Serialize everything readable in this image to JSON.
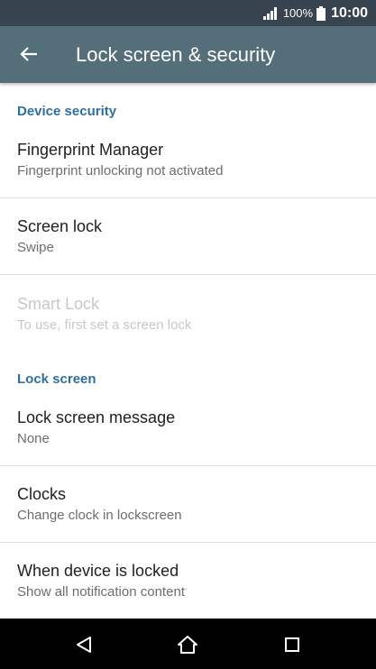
{
  "status_bar": {
    "battery_percent": "100%",
    "time": "10:00",
    "icons": [
      "signal-icon",
      "battery-icon"
    ]
  },
  "app_bar": {
    "title": "Lock screen & security",
    "back_icon": "arrow-back-icon",
    "color": "#546e7a"
  },
  "sections": [
    {
      "header": "Device security",
      "items": [
        {
          "title": "Fingerprint Manager",
          "subtitle": "Fingerprint unlocking not activated",
          "enabled": true
        },
        {
          "title": "Screen lock",
          "subtitle": "Swipe",
          "enabled": true
        },
        {
          "title": "Smart Lock",
          "subtitle": "To use, first set a screen lock",
          "enabled": false
        }
      ]
    },
    {
      "header": "Lock screen",
      "items": [
        {
          "title": "Lock screen message",
          "subtitle": "None",
          "enabled": true
        },
        {
          "title": "Clocks",
          "subtitle": "Change clock in lockscreen",
          "enabled": true
        },
        {
          "title": "When device is locked",
          "subtitle": "Show all notification content",
          "enabled": true
        }
      ]
    }
  ],
  "nav_bar": {
    "icons": [
      "back-triangle-icon",
      "home-icon",
      "recents-icon"
    ]
  },
  "colors": {
    "accent": "#2f6f9e",
    "status_bar": "#37444f"
  }
}
